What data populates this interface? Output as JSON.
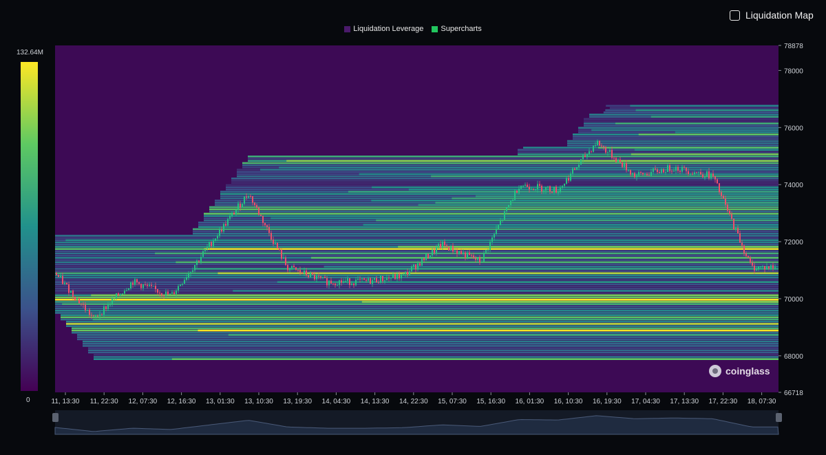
{
  "toggle": {
    "label": "Liquidation Map",
    "checked": false
  },
  "legend": [
    {
      "label": "Liquidation Leverage",
      "color": "#4a1a6b"
    },
    {
      "label": "Supercharts",
      "color": "#22c55e"
    }
  ],
  "colorbar": {
    "max_label": "132.64M",
    "min_label": "0"
  },
  "watermark": {
    "text": "coinglass"
  },
  "chart_data": {
    "type": "heatmap",
    "y_axis": {
      "min": 66718,
      "max": 78878,
      "ticks": [
        "78878",
        "78000",
        "76000",
        "74000",
        "72000",
        "70000",
        "68000",
        "66718"
      ]
    },
    "x_axis": {
      "tick_labels": [
        "11, 13:30",
        "11, 22:30",
        "12, 07:30",
        "12, 16:30",
        "13, 01:30",
        "13, 10:30",
        "13, 19:30",
        "14, 04:30",
        "14, 13:30",
        "14, 22:30",
        "15, 07:30",
        "15, 16:30",
        "16, 01:30",
        "16, 10:30",
        "16, 19:30",
        "17, 04:30",
        "17, 13:30",
        "17, 22:30",
        "18, 07:30"
      ]
    },
    "colorscale": {
      "min": 0,
      "max": 132640000,
      "colors": [
        "#440154",
        "#3b528b",
        "#21918c",
        "#5ec962",
        "#fde725"
      ]
    },
    "price_series": {
      "name": "Supercharts",
      "x_index": [
        0,
        1,
        2,
        3,
        4,
        5,
        6,
        7,
        8,
        9,
        10,
        11,
        12,
        13,
        14,
        15,
        16,
        17,
        18
      ],
      "close": [
        70900,
        69300,
        70600,
        70100,
        71900,
        73700,
        71100,
        70600,
        70600,
        70800,
        71900,
        71300,
        74000,
        73800,
        75500,
        74300,
        74600,
        74300,
        71100
      ]
    },
    "liquidation_bands": [
      {
        "price": 70000,
        "level": 1.0
      },
      {
        "price": 70100,
        "level": 0.95
      },
      {
        "price": 69400,
        "level": 0.9
      },
      {
        "price": 69150,
        "level": 0.95
      },
      {
        "price": 68950,
        "level": 0.85
      },
      {
        "price": 70900,
        "level": 0.7
      },
      {
        "price": 73200,
        "level": 0.9
      },
      {
        "price": 73000,
        "level": 0.85
      },
      {
        "price": 72500,
        "level": 0.8
      },
      {
        "price": 74800,
        "level": 0.85
      },
      {
        "price": 75050,
        "level": 0.7
      },
      {
        "price": 71800,
        "level": 0.75
      },
      {
        "price": 72000,
        "level": 0.5
      }
    ]
  }
}
